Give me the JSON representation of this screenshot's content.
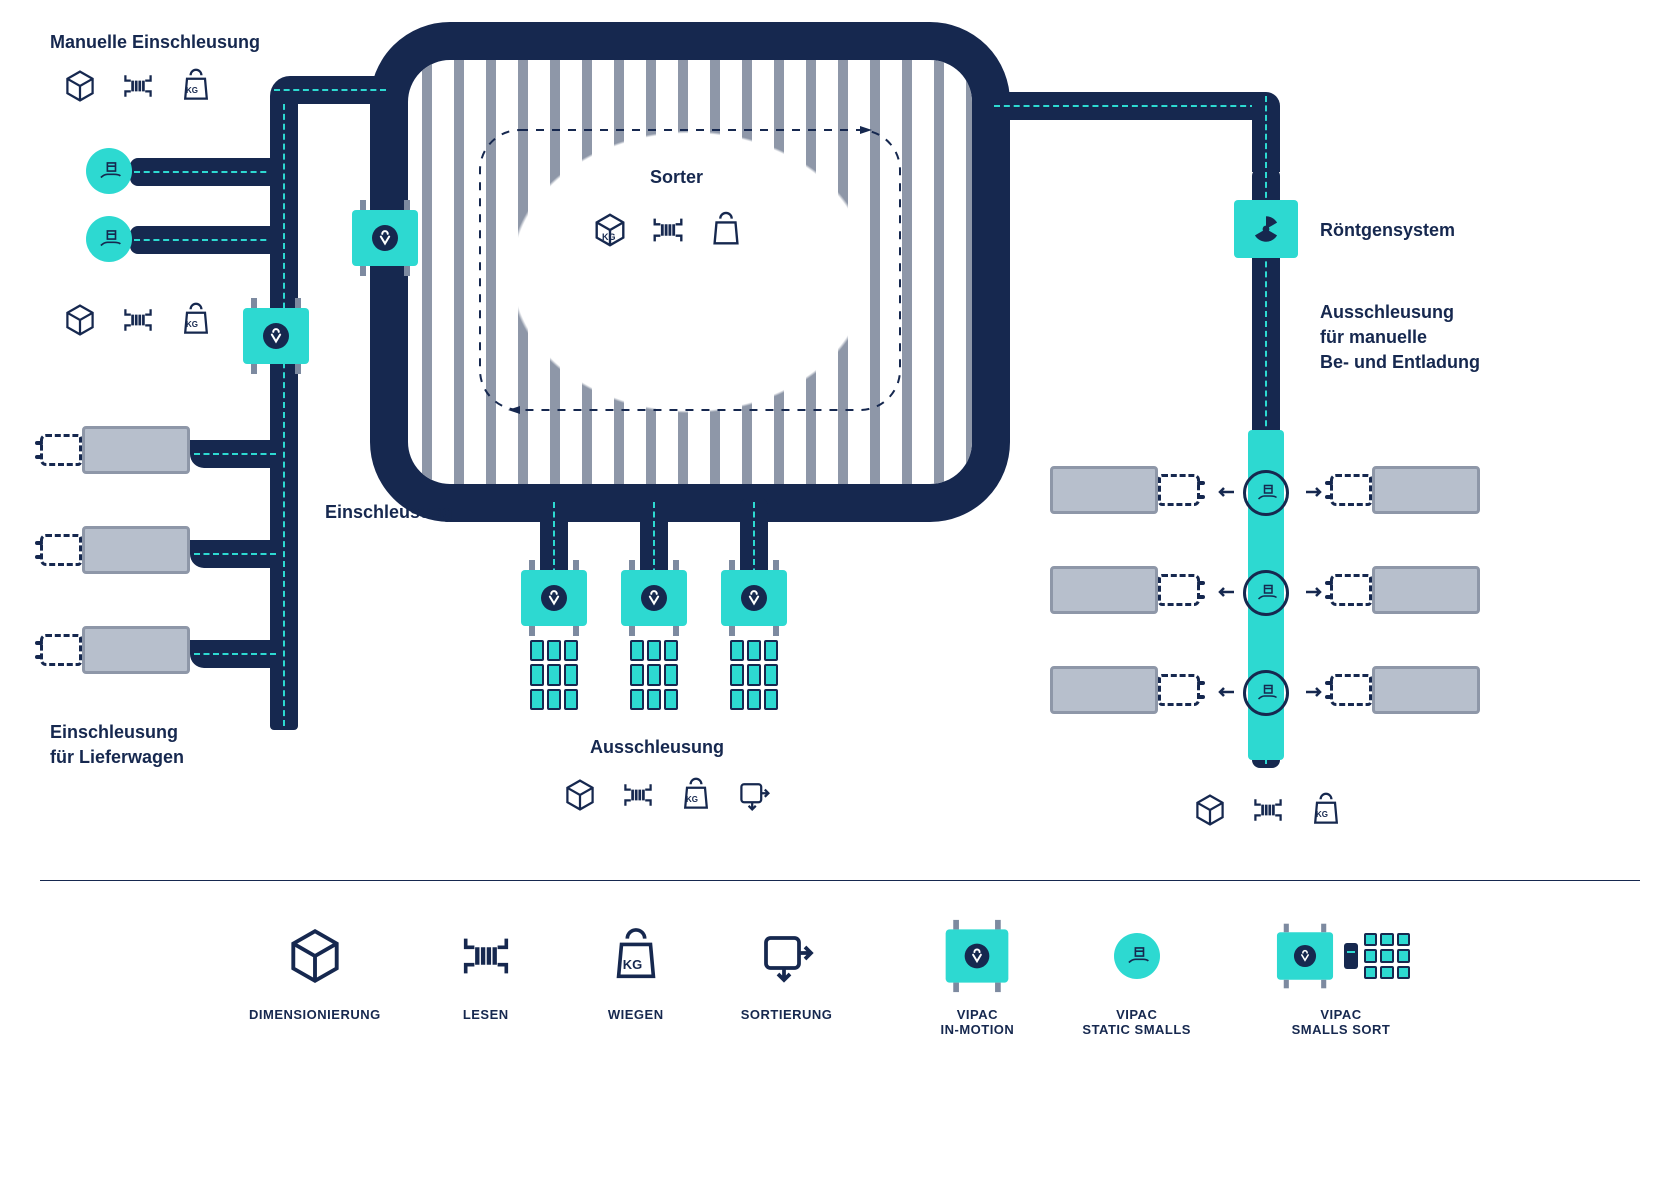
{
  "labels": {
    "manual_induction": "Manuelle Einschleusung",
    "sorter": "Sorter",
    "xray": "Röntgensystem",
    "outlet_manual_lines": [
      "Ausschleusung",
      "für manuelle",
      "Be- und Entladung"
    ],
    "induction": "Einschleusung",
    "van_induction_lines": [
      "Einschleusung",
      "für Lieferwagen"
    ],
    "outlet": "Ausschleusung"
  },
  "legend": {
    "dim": "DIMENSIONIERUNG",
    "read": "LESEN",
    "weigh": "WIEGEN",
    "sort": "SORTIERUNG",
    "vipac_inmotion_lines": [
      "VIPAC",
      "IN-MOTION"
    ],
    "vipac_static_lines": [
      "VIPAC",
      "STATIC SMALLS"
    ],
    "vipac_smallssort_lines": [
      "VIPAC",
      "SMALLS SORT"
    ]
  },
  "kg_label": "KG"
}
